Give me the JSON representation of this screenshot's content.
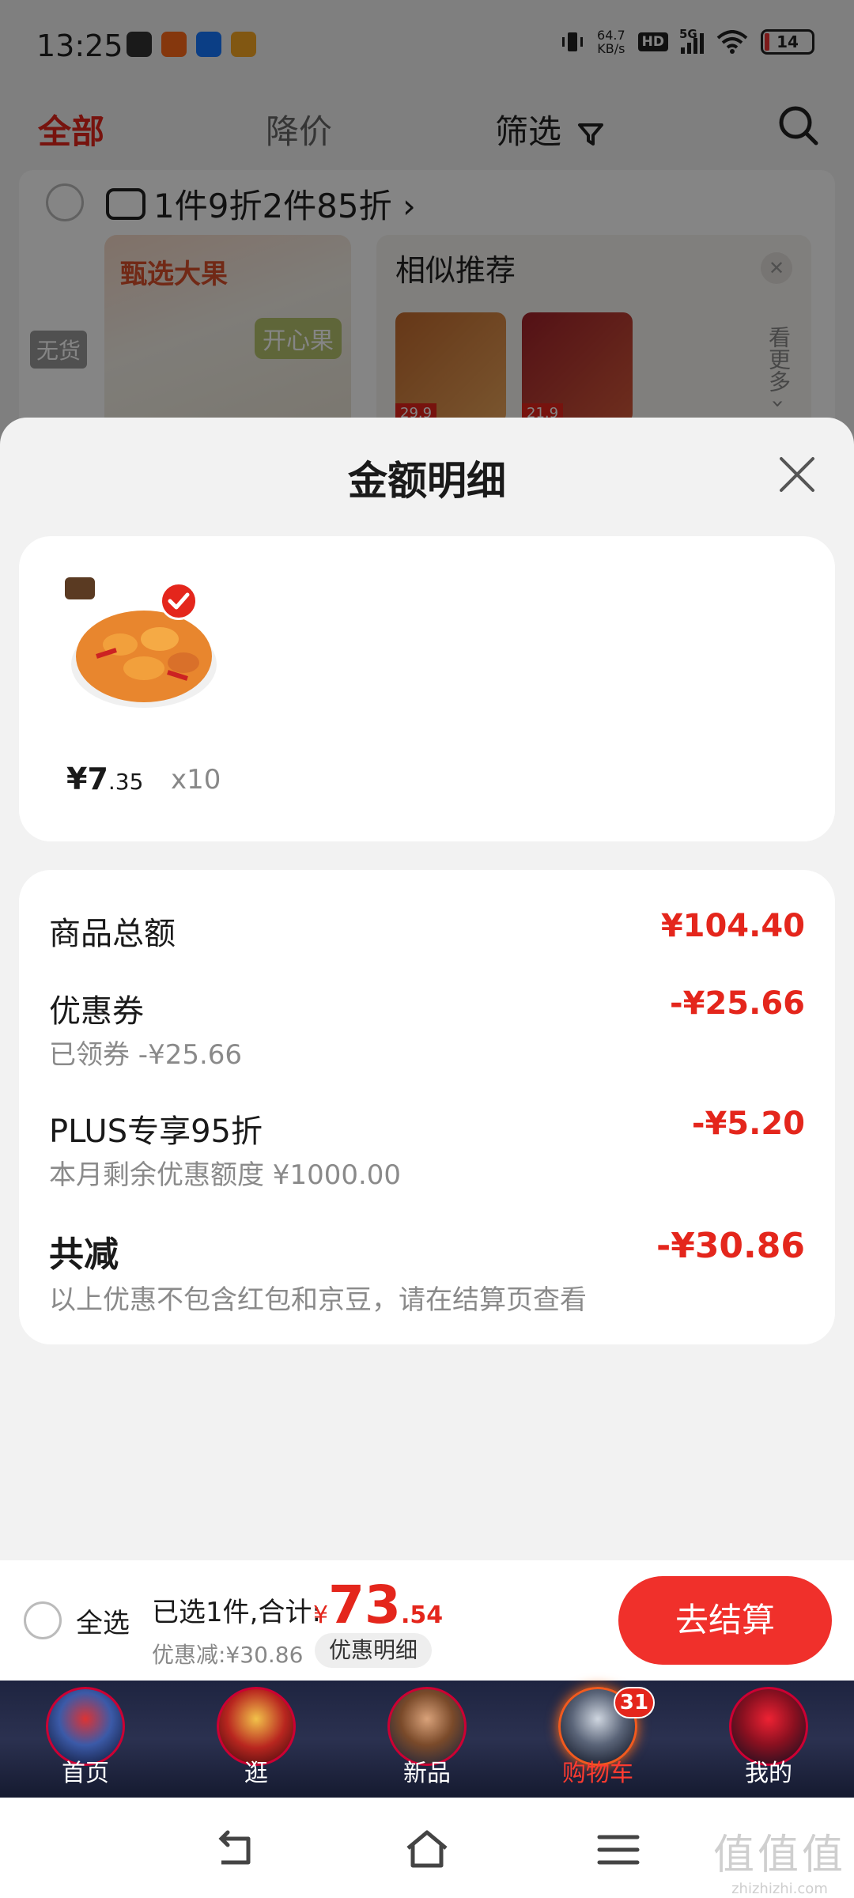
{
  "status": {
    "time": "13:25",
    "net_speed": "64.7",
    "net_unit": "KB/s",
    "hd": "HD",
    "net_type": "5G",
    "battery": "14"
  },
  "top_tabs": {
    "all": "全部",
    "price_drop": "降价",
    "filter": "筛选"
  },
  "shop": {
    "promo": "1件9折2件85折 ›",
    "product_label_1": "甄选大果",
    "product_label_2": "开心果",
    "out_of_stock": "无货",
    "similar_title": "相似推荐",
    "similar_prices": [
      "29.9",
      "21.9"
    ],
    "see_more": "看更多 ›"
  },
  "sheet": {
    "title": "金额明细",
    "goods": {
      "price_yen": "¥7",
      "price_dec": ".35",
      "quantity": "x10"
    },
    "rows": {
      "subtotal_label": "商品总额",
      "subtotal_value": "¥104.40",
      "coupon_label": "优惠券",
      "coupon_sub": "已领券 -¥25.66",
      "coupon_value": "-¥25.66",
      "plus_label": "PLUS专享95折",
      "plus_sub": "本月剩余优惠额度 ¥1000.00",
      "plus_value": "-¥5.20",
      "total_cut_label": "共减",
      "total_cut_sub": "以上优惠不包含红包和京豆，请在结算页查看",
      "total_cut_value": "-¥30.86"
    }
  },
  "checkout": {
    "select_all": "全选",
    "selected_summary": "已选1件,合计:",
    "total_yen": "¥",
    "total_int": "73",
    "total_dec": ".54",
    "discount_summary": "优惠减:¥30.86",
    "detail_button": "优惠明细",
    "pay_button": "去结算"
  },
  "tabbar": {
    "items": [
      {
        "label": "首页",
        "icon": "home-avatar-icon"
      },
      {
        "label": "逛",
        "icon": "browse-avatar-icon"
      },
      {
        "label": "新品",
        "icon": "new-avatar-icon"
      },
      {
        "label": "购物车",
        "icon": "cart-avatar-icon"
      },
      {
        "label": "我的",
        "icon": "mine-avatar-icon"
      }
    ],
    "cart_badge": "31",
    "active_index": 3
  },
  "watermark": {
    "big": "值值值",
    "small": "zhizhizhi.com"
  },
  "colors": {
    "accent_red": "#e4261c",
    "pay_button": "#f0302b",
    "tabbar_bg": "#1e2440"
  }
}
